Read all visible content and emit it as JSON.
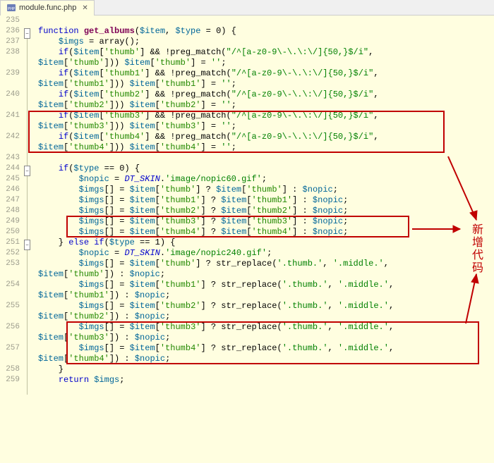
{
  "tab": {
    "filename": "module.func.php",
    "close": "✕"
  },
  "annotation": "新增代码",
  "lines": [
    {
      "n": 235,
      "c": ""
    },
    {
      "n": 236,
      "fold": "open",
      "c": "<span class='kw'>function</span> <span class='fname'>get_albums</span>(<span class='var'>$item</span>, <span class='var'>$type</span> = <span class='num'>0</span>) {"
    },
    {
      "n": 237,
      "c": "    <span class='var'>$imgs</span> = <span class='call'>array</span>();"
    },
    {
      "n": 238,
      "c": "    <span class='kw'>if</span>(<span class='var'>$item</span>[<span class='strk'>'thumb'</span>] && !<span class='call'>preg_match</span>(<span class='str'>\"/^[a-z0-9\\-\\.\\:\\/]{50,}$/i\"</span>,"
    },
    {
      "n": "",
      "c": "<span class='var'>$item</span>[<span class='strk'>'thumb'</span>])) <span class='var'>$item</span>[<span class='strk'>'thumb'</span>] = <span class='str'>''</span>;"
    },
    {
      "n": 239,
      "c": "    <span class='kw'>if</span>(<span class='var'>$item</span>[<span class='strk'>'thumb1'</span>] && !<span class='call'>preg_match</span>(<span class='str'>\"/^[a-z0-9\\-\\.\\:\\/]{50,}$/i\"</span>,"
    },
    {
      "n": "",
      "c": "<span class='var'>$item</span>[<span class='strk'>'thumb1'</span>])) <span class='var'>$item</span>[<span class='strk'>'thumb1'</span>] = <span class='str'>''</span>;"
    },
    {
      "n": 240,
      "c": "    <span class='kw'>if</span>(<span class='var'>$item</span>[<span class='strk'>'thumb2'</span>] && !<span class='call'>preg_match</span>(<span class='str'>\"/^[a-z0-9\\-\\.\\:\\/]{50,}$/i\"</span>,"
    },
    {
      "n": "",
      "c": "<span class='var'>$item</span>[<span class='strk'>'thumb2'</span>])) <span class='var'>$item</span>[<span class='strk'>'thumb2'</span>] = <span class='str'>''</span>;"
    },
    {
      "n": 241,
      "c": "    <span class='kw'>if</span>(<span class='var'>$item</span>[<span class='strk'>'thumb3'</span>] && !<span class='call'>preg_match</span>(<span class='str'>\"/^[a-z0-9\\-\\.\\:\\/]{50,}$/i\"</span>,"
    },
    {
      "n": "",
      "c": "<span class='var'>$item</span>[<span class='strk'>'thumb3'</span>])) <span class='var'>$item</span>[<span class='strk'>'thumb3'</span>] = <span class='str'>''</span>;"
    },
    {
      "n": 242,
      "c": "    <span class='kw'>if</span>(<span class='var'>$item</span>[<span class='strk'>'thumb4'</span>] && !<span class='call'>preg_match</span>(<span class='str'>\"/^[a-z0-9\\-\\.\\:\\/]{50,}$/i\"</span>,"
    },
    {
      "n": "",
      "c": "<span class='var'>$item</span>[<span class='strk'>'thumb4'</span>])) <span class='var'>$item</span>[<span class='strk'>'thumb4'</span>] = <span class='str'>''</span>;"
    },
    {
      "n": 243,
      "c": ""
    },
    {
      "n": 244,
      "fold": "open",
      "c": "    <span class='kw'>if</span>(<span class='var'>$type</span> == <span class='num'>0</span>) {"
    },
    {
      "n": 245,
      "c": "        <span class='var'>$nopic</span> = <span class='const'>DT_SKIN</span>.<span class='str'>'image/nopic60.gif'</span>;"
    },
    {
      "n": 246,
      "c": "        <span class='var'>$imgs</span>[] = <span class='var'>$item</span>[<span class='strk'>'thumb'</span>] ? <span class='var'>$item</span>[<span class='strk'>'thumb'</span>] : <span class='var'>$nopic</span>;"
    },
    {
      "n": 247,
      "c": "        <span class='var'>$imgs</span>[] = <span class='var'>$item</span>[<span class='strk'>'thumb1'</span>] ? <span class='var'>$item</span>[<span class='strk'>'thumb1'</span>] : <span class='var'>$nopic</span>;"
    },
    {
      "n": 248,
      "c": "        <span class='var'>$imgs</span>[] = <span class='var'>$item</span>[<span class='strk'>'thumb2'</span>] ? <span class='var'>$item</span>[<span class='strk'>'thumb2'</span>] : <span class='var'>$nopic</span>;"
    },
    {
      "n": 249,
      "c": "        <span class='var'>$imgs</span>[] = <span class='var'>$item</span>[<span class='strk'>'thumb3'</span>] ? <span class='var'>$item</span>[<span class='strk'>'thumb3'</span>] : <span class='var'>$nopic</span>;"
    },
    {
      "n": 250,
      "c": "        <span class='var'>$imgs</span>[] = <span class='var'>$item</span>[<span class='strk'>'thumb4'</span>] ? <span class='var'>$item</span>[<span class='strk'>'thumb4'</span>] : <span class='var'>$nopic</span>;"
    },
    {
      "n": 251,
      "fold": "open",
      "c": "    } <span class='kw'>else if</span>(<span class='var'>$type</span> == <span class='num'>1</span>) {"
    },
    {
      "n": 252,
      "c": "        <span class='var'>$nopic</span> = <span class='const'>DT_SKIN</span>.<span class='str'>'image/nopic240.gif'</span>;"
    },
    {
      "n": 253,
      "c": "        <span class='var'>$imgs</span>[] = <span class='var'>$item</span>[<span class='strk'>'thumb'</span>] ? <span class='call'>str_replace</span>(<span class='str'>'.thumb.'</span>, <span class='str'>'.middle.'</span>,"
    },
    {
      "n": "",
      "c": "<span class='var'>$item</span>[<span class='strk'>'thumb'</span>]) : <span class='var'>$nopic</span>;"
    },
    {
      "n": 254,
      "c": "        <span class='var'>$imgs</span>[] = <span class='var'>$item</span>[<span class='strk'>'thumb1'</span>] ? <span class='call'>str_replace</span>(<span class='str'>'.thumb.'</span>, <span class='str'>'.middle.'</span>,"
    },
    {
      "n": "",
      "c": "<span class='var'>$item</span>[<span class='strk'>'thumb1'</span>]) : <span class='var'>$nopic</span>;"
    },
    {
      "n": 255,
      "c": "        <span class='var'>$imgs</span>[] = <span class='var'>$item</span>[<span class='strk'>'thumb2'</span>] ? <span class='call'>str_replace</span>(<span class='str'>'.thumb.'</span>, <span class='str'>'.middle.'</span>,"
    },
    {
      "n": "",
      "c": "<span class='var'>$item</span>[<span class='strk'>'thumb2'</span>]) : <span class='var'>$nopic</span>;"
    },
    {
      "n": 256,
      "c": "        <span class='var'>$imgs</span>[] = <span class='var'>$item</span>[<span class='strk'>'thumb3'</span>] ? <span class='call'>str_replace</span>(<span class='str'>'.thumb.'</span>, <span class='str'>'.middle.'</span>,"
    },
    {
      "n": "",
      "c": "<span class='var'>$item</span>[<span class='strk'>'thumb3'</span>]) : <span class='var'>$nopic</span>;"
    },
    {
      "n": 257,
      "c": "        <span class='var'>$imgs</span>[] = <span class='var'>$item</span>[<span class='strk'>'thumb4'</span>] ? <span class='call'>str_replace</span>(<span class='str'>'.thumb.'</span>, <span class='str'>'.middle.'</span>,"
    },
    {
      "n": "",
      "c": "<span class='var'>$item</span>[<span class='strk'>'thumb4'</span>]) : <span class='var'>$nopic</span>;"
    },
    {
      "n": 258,
      "c": "    }"
    },
    {
      "n": 259,
      "c": "    <span class='kw'>return</span> <span class='var'>$imgs</span>;"
    }
  ]
}
